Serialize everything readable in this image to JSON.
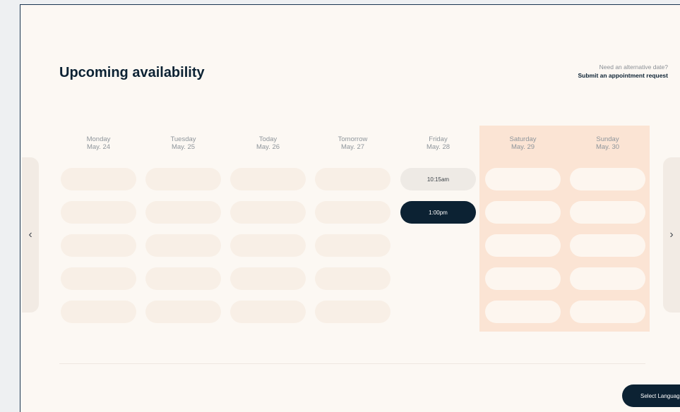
{
  "header": {
    "title": "Upcoming availability",
    "alt_question": "Need an alternative date?",
    "alt_link": "Submit an appointment request"
  },
  "days": [
    {
      "name": "Monday",
      "date": "May. 24"
    },
    {
      "name": "Tuesday",
      "date": "May. 25"
    },
    {
      "name": "Today",
      "date": "May. 26"
    },
    {
      "name": "Tomorrow",
      "date": "May. 27"
    },
    {
      "name": "Friday",
      "date": "May. 28"
    },
    {
      "name": "Saturday",
      "date": "May. 29"
    },
    {
      "name": "Sunday",
      "date": "May. 30"
    }
  ],
  "times": {
    "friday_1": "10:15am",
    "friday_2": "1:00pm"
  },
  "nav": {
    "prev": "‹",
    "next": "›"
  },
  "language_button": "Select Language",
  "colors": {
    "accent": "#0c2233",
    "weekend_highlight": "#fbe4d4",
    "panel_bg": "#fcf8f3"
  }
}
